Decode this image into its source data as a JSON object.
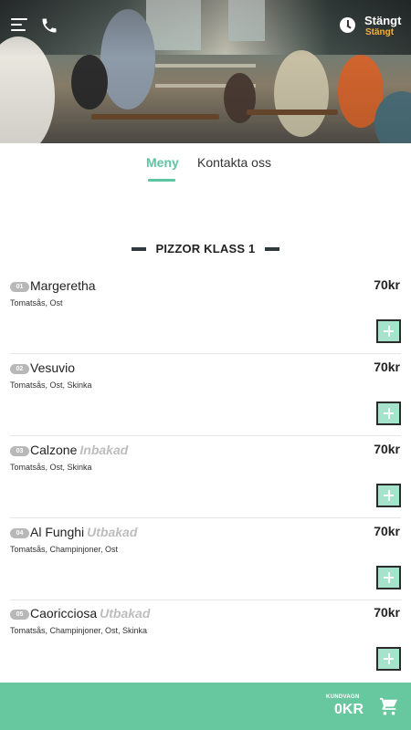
{
  "header": {
    "status_title": "Stängt",
    "status_subtitle": "Stängt",
    "icons": [
      "menu-icon",
      "phone-icon",
      "clock-icon"
    ]
  },
  "tabs": [
    {
      "label": "Meny",
      "active": true
    },
    {
      "label": "Kontakta oss",
      "active": false
    }
  ],
  "section": {
    "title": "PIZZOR KLASS 1"
  },
  "items": [
    {
      "number": "01",
      "name": "Margeretha",
      "tag": "",
      "price": "70kr",
      "ingredients": "Tomatsås, Ost"
    },
    {
      "number": "02",
      "name": "Vesuvio",
      "tag": "",
      "price": "70kr",
      "ingredients": "Tomatsås, Ost, Skinka"
    },
    {
      "number": "03",
      "name": "Calzone",
      "tag": "Inbakad",
      "price": "70kr",
      "ingredients": "Tomatsås, Ost, Skinka"
    },
    {
      "number": "04",
      "name": "Al Funghi",
      "tag": "Utbakad",
      "price": "70kr",
      "ingredients": "Tomatsås, Champinjoner, Ost"
    },
    {
      "number": "05",
      "name": "Caoricciosa",
      "tag": "Utbakad",
      "price": "70kr",
      "ingredients": "Tomatsås, Champinjoner, Ost, Skinka"
    }
  ],
  "cart": {
    "label": "KUNDVAGN",
    "total": "0KR"
  },
  "colors": {
    "accent": "#5cc5a1",
    "cart_bar": "#67c79e",
    "status_sub": "#f3b13b",
    "add_button": "#a6e3cc"
  }
}
